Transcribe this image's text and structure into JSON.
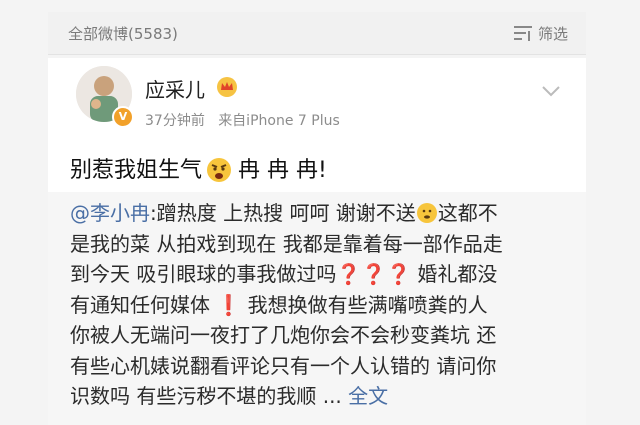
{
  "header": {
    "count_label": "全部微博(5583)",
    "filter_label": "筛选"
  },
  "post": {
    "username": "应采儿",
    "time": "37分钟前",
    "source": "来自iPhone 7 Plus",
    "text_part1": "别惹我姐生气",
    "text_part2": "冉 冉 冉!",
    "repost": {
      "mention": "@李小冉",
      "line1_a": ":蹭热度 上热搜 呵呵 谢谢不送",
      "line1_b": "这都不",
      "line2": "是我的菜 从拍戏到现在 我都是靠着每一部作品走",
      "line3_a": "到今天 吸引眼球的事我做过吗",
      "q1": "❓",
      "q2": "❓",
      "q3": "❓",
      "line3_b": " 婚礼都没",
      "line4_a": "有通知任何媒体 ",
      "excl": "❗",
      "line4_b": " 我想换做有些满嘴喷粪的人",
      "line5": "你被人无端问一夜打了几炮你会不会秒变粪坑 还",
      "line6": "有些心机婊说翻看评论只有一个人认错的 请问你",
      "line7": "识数吗 有些污秽不堪的我顺 ... ",
      "full_link": "全文"
    }
  },
  "colors": {
    "link": "#4a6fa5",
    "accent": "#f2a12a"
  }
}
